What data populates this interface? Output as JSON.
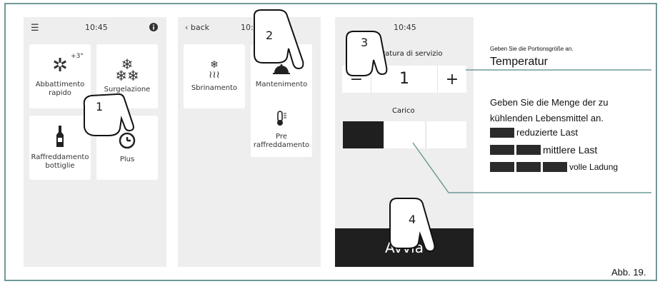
{
  "screen1": {
    "time": "10:45",
    "tiles": [
      {
        "label": "Abbattimento\nrapido",
        "badge": "+3°",
        "icon": "snowflake-icon"
      },
      {
        "label": "Surgelazione",
        "icon": "multi-snowflake-icon"
      },
      {
        "label": "Raffreddamento\nbottiglie",
        "icon": "bottle-icon"
      },
      {
        "label": "Plus",
        "icon": "plus-clock-icon"
      }
    ],
    "hand_number": "1"
  },
  "screen2": {
    "back_label": "back",
    "time": "10:45",
    "tiles": [
      {
        "label": "Sbrinamento",
        "icon": "defrost-icon"
      },
      {
        "label": "Mantenimento",
        "icon": "cloche-icon"
      },
      {
        "label": "Pre\nraffreddamento",
        "icon": "thermometer-icon"
      }
    ],
    "hand_number": "2"
  },
  "screen3": {
    "time": "10:45",
    "section_title": "ratura di servizio",
    "stepper": {
      "minus": "−",
      "value": "1",
      "plus": "+"
    },
    "load_title": "Carico",
    "start_label": "Avvia",
    "hand_number_top": "3",
    "hand_number_bottom": "4"
  },
  "annotations": {
    "portion_hint": "Geben Sie die Portionsgröße an.",
    "temperature_label": "Temperatur",
    "quantity_line1": "Geben Sie die Menge der zu",
    "quantity_line2": "kühlenden Lebensmittel an.",
    "load_reduced": "reduzierte Last",
    "load_medium": "mittlere Last",
    "load_full": "volle Ladung",
    "figure_caption": "Abb. 19."
  }
}
